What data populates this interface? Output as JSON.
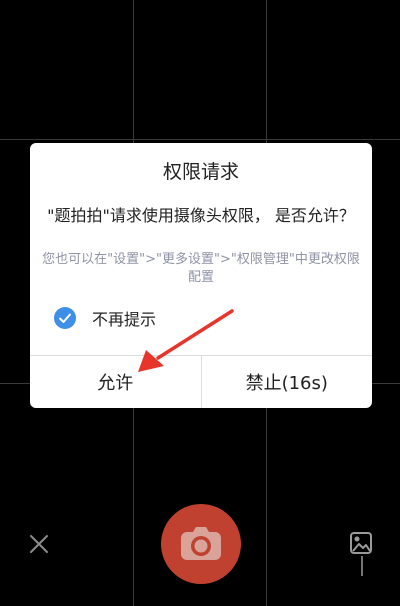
{
  "dialog": {
    "title": "权限请求",
    "message": "\"题拍拍\"请求使用摄像头权限， 是否允许？",
    "hint": "您也可以在\"设置\">\"更多设置\">\"权限管理\"中更改权限配置",
    "checkbox_label": "不再提示",
    "checkbox_checked": true,
    "allow_button": "允许",
    "deny_button": "禁止(16s)"
  },
  "colors": {
    "background": "#000000",
    "dialog_bg": "#ffffff",
    "checkbox": "#3e8fe8",
    "hint_text": "#8f93a6",
    "shutter": "#c0412f",
    "annotation_arrow": "#e8352a"
  },
  "icons": [
    "close-icon",
    "camera-icon",
    "album-icon",
    "check-icon"
  ]
}
